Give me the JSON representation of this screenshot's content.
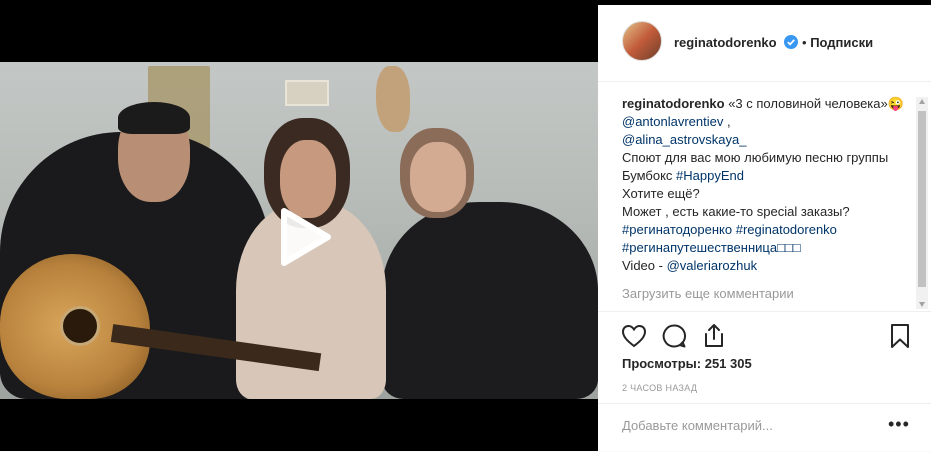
{
  "post": {
    "username": "reginatodorenko",
    "follow_separator": "•",
    "follow_label": "Подписки"
  },
  "caption": {
    "author": "reginatodorenko",
    "text1": "«3 с половиной человека»😜 ",
    "mention1": "@antonlavrentiev",
    "text2": " ,",
    "mention2": "@alina_astrovskaya_",
    "line3": "Споют для вас мою любимую песню группы Бумбокс ",
    "hashtag1": "#HappyEnd",
    "line4": "Хотите ещё?",
    "line5": "Может , есть какие-то special заказы?",
    "hashtag2": "#регинатодоренко",
    "hashtag3": "#reginatodorenko",
    "hashtag4": "#регинапутешественница□□□",
    "video_label": "Video - ",
    "mention3": "@valeriarozhuk"
  },
  "load_more": "Загрузить еще комментарии",
  "stats": {
    "views_label": "Просмотры:",
    "views_value": "251 305",
    "time": "2 часов назад"
  },
  "comment": {
    "placeholder": "Добавьте комментарий..."
  },
  "icons": {
    "like": "heart-icon",
    "comment": "comment-icon",
    "share": "share-icon",
    "save": "bookmark-icon",
    "more": "more-options-icon",
    "play": "play-icon",
    "verified": "verified-badge-icon"
  },
  "colors": {
    "link": "#003569",
    "verified": "#3897f0",
    "muted": "#999999"
  }
}
